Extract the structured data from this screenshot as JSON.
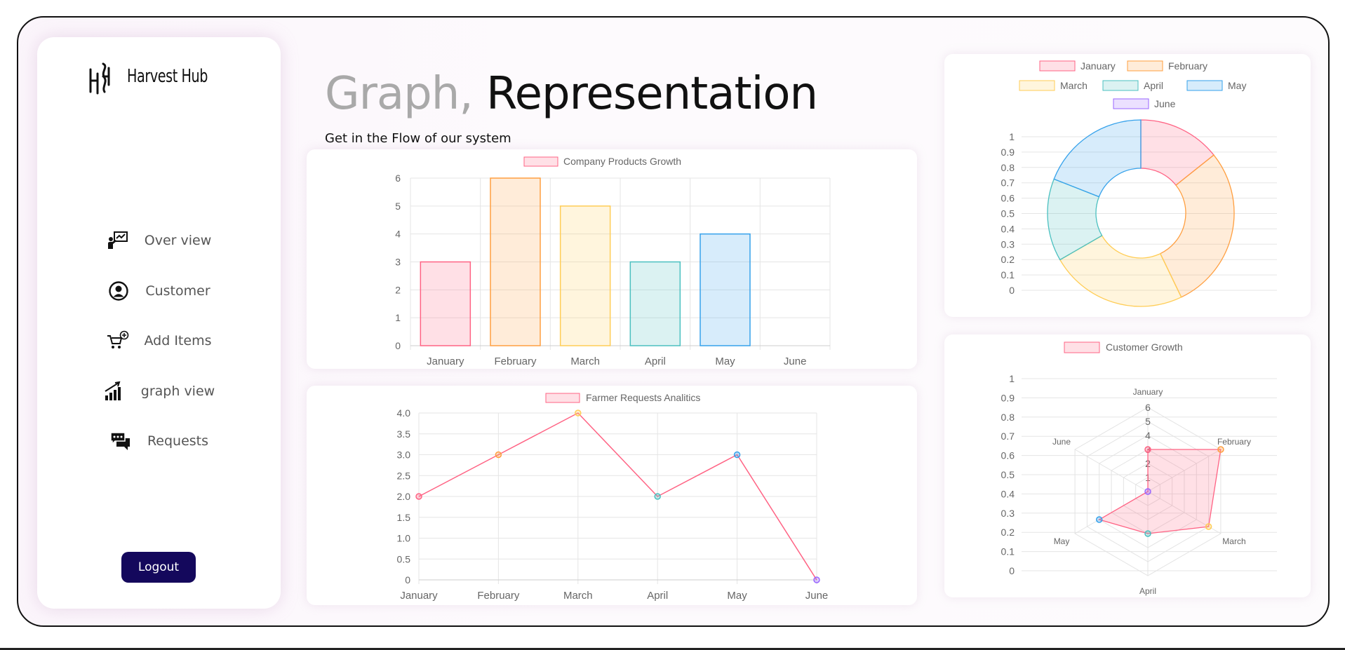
{
  "brand": {
    "name": "Harvest Hub",
    "logo_icon": "hh-logo-icon"
  },
  "nav": [
    {
      "label": "Over view",
      "icon": "presentation-icon"
    },
    {
      "label": "Customer",
      "icon": "user-circle-icon"
    },
    {
      "label": "Add Items",
      "icon": "cart-plus-icon"
    },
    {
      "label": "graph view",
      "icon": "chart-up-icon"
    },
    {
      "label": "Requests",
      "icon": "chat-bubbles-icon"
    }
  ],
  "logout_label": "Logout",
  "header": {
    "title_part1": "Graph,",
    "title_part2": "Representation",
    "subtitle": "Get in the Flow of our system"
  },
  "colors": {
    "pink": "#ff6384",
    "orange": "#ff9f40",
    "yellow": "#ffcd56",
    "teal": "#4bc0c0",
    "blue": "#36a2eb",
    "purple": "#9966ff",
    "logout_bg": "#14085c"
  },
  "chart_data": [
    {
      "type": "bar",
      "legend": "Company Products Growth",
      "categories": [
        "January",
        "February",
        "March",
        "April",
        "May",
        "June"
      ],
      "values": [
        3,
        6,
        5,
        3,
        4,
        0
      ],
      "ylim": [
        0,
        6
      ],
      "yticks": [
        "0",
        "1",
        "2",
        "3",
        "4",
        "5",
        "6"
      ],
      "grid": true,
      "legend_position": "top"
    },
    {
      "type": "line",
      "legend": "Farmer Requests Analitics",
      "categories": [
        "January",
        "February",
        "March",
        "April",
        "May",
        "June"
      ],
      "values": [
        2,
        3,
        4,
        2,
        3,
        0
      ],
      "ylim": [
        0,
        4
      ],
      "yticks": [
        "0",
        "0.5",
        "1.0",
        "1.5",
        "2.0",
        "2.5",
        "3.0",
        "3.5",
        "4.0"
      ],
      "grid": true,
      "legend_position": "top"
    },
    {
      "type": "pie",
      "variant": "doughnut",
      "legend": [
        "January",
        "February",
        "March",
        "April",
        "May",
        "June"
      ],
      "values": [
        3,
        6,
        5,
        3,
        4,
        0
      ],
      "yticks": [
        "0",
        "0.1",
        "0.2",
        "0.3",
        "0.4",
        "0.5",
        "0.6",
        "0.7",
        "0.8",
        "0.9",
        "1"
      ],
      "legend_position": "top"
    },
    {
      "type": "radar",
      "legend": "Customer Growth",
      "categories": [
        "January",
        "February",
        "March",
        "April",
        "May",
        "June"
      ],
      "values": [
        3,
        6,
        5,
        3,
        4,
        0
      ],
      "rlim": [
        0,
        6
      ],
      "rticks": [
        "1",
        "2",
        "3",
        "4",
        "5",
        "6"
      ],
      "yticks": [
        "0",
        "0.1",
        "0.2",
        "0.3",
        "0.4",
        "0.5",
        "0.6",
        "0.7",
        "0.8",
        "0.9",
        "1"
      ],
      "legend_position": "top"
    }
  ]
}
